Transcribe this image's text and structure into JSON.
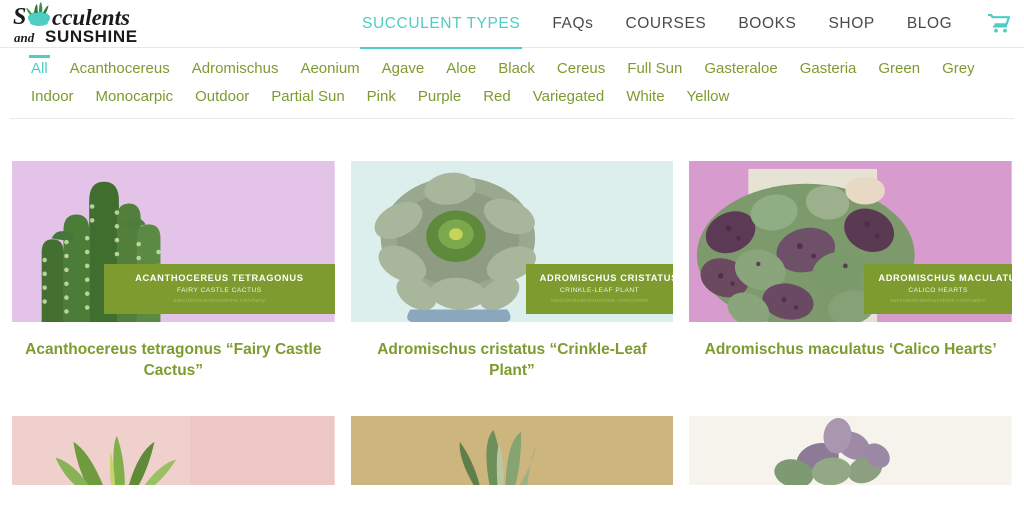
{
  "site": {
    "logo_line1": "Succulents",
    "logo_line2_prefix": "and",
    "logo_line2": "SUNSHINE"
  },
  "nav": {
    "items": [
      {
        "label": "SUCCULENT TYPES",
        "active": true
      },
      {
        "label": "FAQs",
        "active": false
      },
      {
        "label": "COURSES",
        "active": false
      },
      {
        "label": "BOOKS",
        "active": false
      },
      {
        "label": "SHOP",
        "active": false
      },
      {
        "label": "BLOG",
        "active": false
      }
    ],
    "cart_icon": "shopping-cart-icon",
    "search_icon": "search-icon",
    "accent_color": "#4ecdc4"
  },
  "filters": {
    "tags": [
      {
        "label": "All",
        "active": true
      },
      {
        "label": "Acanthocereus",
        "active": false
      },
      {
        "label": "Adromischus",
        "active": false
      },
      {
        "label": "Aeonium",
        "active": false
      },
      {
        "label": "Agave",
        "active": false
      },
      {
        "label": "Aloe",
        "active": false
      },
      {
        "label": "Black",
        "active": false
      },
      {
        "label": "Cereus",
        "active": false
      },
      {
        "label": "Full Sun",
        "active": false
      },
      {
        "label": "Gasteraloe",
        "active": false
      },
      {
        "label": "Gasteria",
        "active": false
      },
      {
        "label": "Green",
        "active": false
      },
      {
        "label": "Grey",
        "active": false
      },
      {
        "label": "Indoor",
        "active": false
      },
      {
        "label": "Monocarpic",
        "active": false
      },
      {
        "label": "Outdoor",
        "active": false
      },
      {
        "label": "Partial Sun",
        "active": false
      },
      {
        "label": "Pink",
        "active": false
      },
      {
        "label": "Purple",
        "active": false
      },
      {
        "label": "Red",
        "active": false
      },
      {
        "label": "Variegated",
        "active": false
      },
      {
        "label": "White",
        "active": false
      },
      {
        "label": "Yellow",
        "active": false
      }
    ],
    "tag_color": "#7d9b2e",
    "active_color": "#4ecdc4"
  },
  "cards": [
    {
      "overlay_title": "ACANTHOCEREUS TETRAGONUS",
      "overlay_subtitle": "FAIRY CASTLE CACTUS",
      "overlay_url": "succulentsandsunshine.com/fairy",
      "title": "Acanthocereus tetragonus “Fairy Castle Cactus”",
      "bg_color": "#e3c4e8",
      "overlay_align": "left"
    },
    {
      "overlay_title": "ADROMISCHUS CRISTATUS",
      "overlay_subtitle": "CRINKLE-LEAF PLANT",
      "overlay_url": "succulentsandsunshine.com/crinkle",
      "title": "Adromischus cristatus “Crinkle-Leaf Plant”",
      "bg_color": "#dcefed",
      "overlay_align": "right"
    },
    {
      "overlay_title": "ADROMISCHUS MACULATUS",
      "overlay_subtitle": "CALICO HEARTS",
      "overlay_url": "succulentsandsunshine.com/calico",
      "title": "Adromischus maculatus ‘Calico Hearts’",
      "bg_color": "#d79ccd",
      "overlay_align": "right"
    }
  ],
  "cards_row2": [
    {
      "bg_color": "#edc7c4"
    },
    {
      "bg_color": "#cdb57e"
    },
    {
      "bg_color": "#f6f3ec"
    }
  ]
}
